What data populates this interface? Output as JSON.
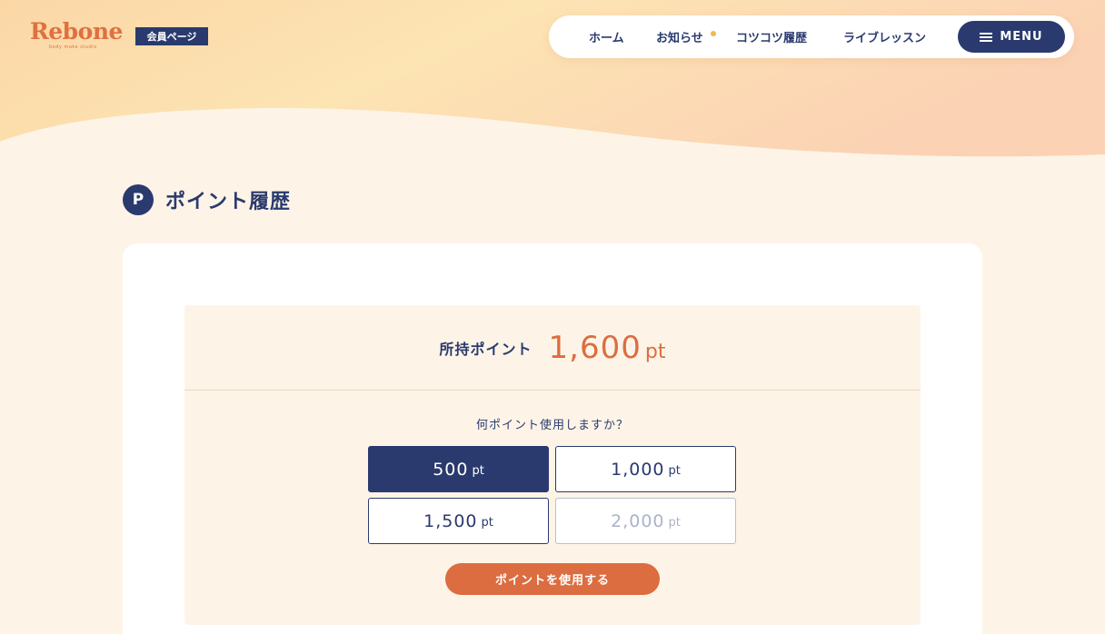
{
  "brand": {
    "logo": "Rebone",
    "tagline": "body make studio",
    "member_badge": "会員ページ"
  },
  "nav": {
    "items": [
      {
        "label": "ホーム"
      },
      {
        "label": "お知らせ",
        "has_notification": true
      },
      {
        "label": "コツコツ履歴"
      },
      {
        "label": "ライブレッスン"
      }
    ],
    "menu_label": "MENU"
  },
  "page": {
    "icon_letter": "P",
    "title": "ポイント履歴"
  },
  "balance": {
    "label": "所持ポイント",
    "value": "1,600",
    "unit": "pt"
  },
  "redeem": {
    "question": "何ポイント使用しますか？",
    "options": [
      {
        "value": "500",
        "unit": "pt",
        "state": "selected"
      },
      {
        "value": "1,000",
        "unit": "pt",
        "state": "available"
      },
      {
        "value": "1,500",
        "unit": "pt",
        "state": "available"
      },
      {
        "value": "2,000",
        "unit": "pt",
        "state": "disabled"
      }
    ],
    "submit_label": "ポイントを使用する"
  },
  "colors": {
    "navy": "#2a3a6e",
    "accent_orange": "#dc6d40",
    "notification_dot": "#f2b94a",
    "page_bg": "#fdf4e7"
  }
}
